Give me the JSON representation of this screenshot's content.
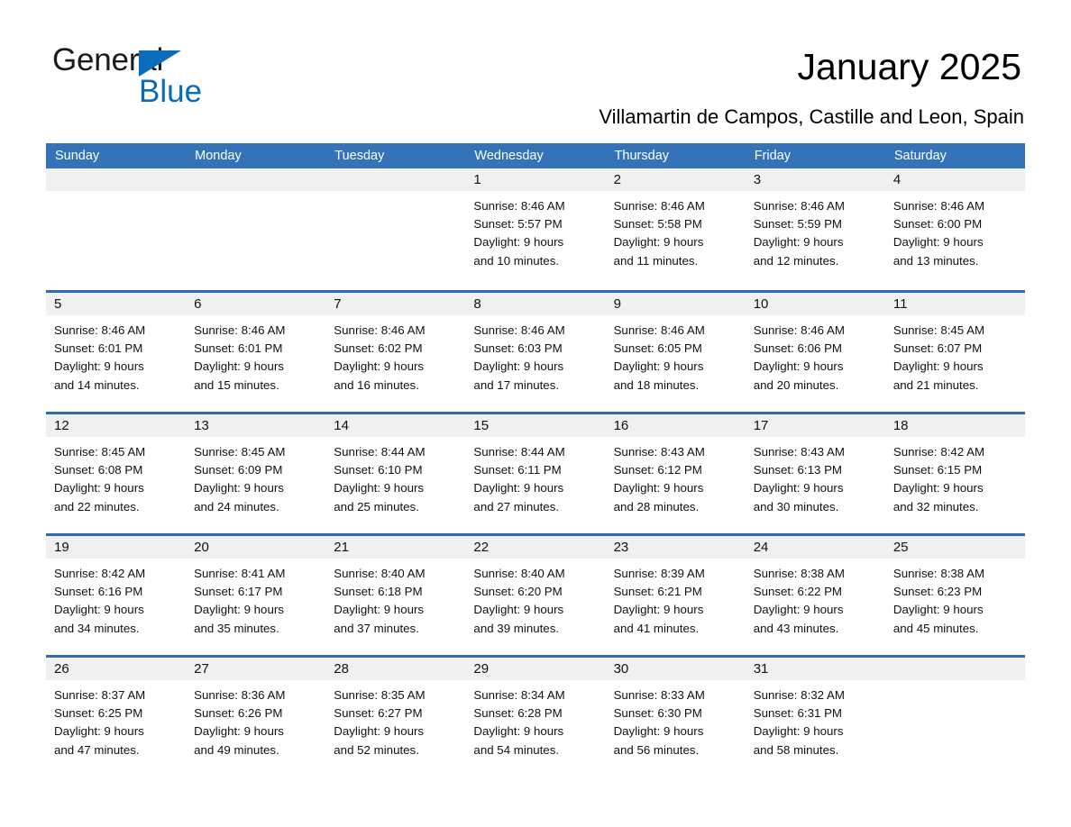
{
  "brand": {
    "name_part1": "General",
    "name_part2": "Blue"
  },
  "header": {
    "title": "January 2025",
    "subtitle": "Villamartin de Campos, Castille and Leon, Spain"
  },
  "colors": {
    "header_blue": "#3573b9",
    "row_divider_blue": "#2e6da9",
    "day_band_gray": "#f0f0f0",
    "brand_blue": "#0a6cb8"
  },
  "weekdays": [
    "Sunday",
    "Monday",
    "Tuesday",
    "Wednesday",
    "Thursday",
    "Friday",
    "Saturday"
  ],
  "weeks": [
    [
      {
        "day": "",
        "empty": true,
        "sunrise": "",
        "sunset": "",
        "daylight1": "",
        "daylight2": ""
      },
      {
        "day": "",
        "empty": true,
        "sunrise": "",
        "sunset": "",
        "daylight1": "",
        "daylight2": ""
      },
      {
        "day": "",
        "empty": true,
        "sunrise": "",
        "sunset": "",
        "daylight1": "",
        "daylight2": ""
      },
      {
        "day": "1",
        "sunrise": "Sunrise: 8:46 AM",
        "sunset": "Sunset: 5:57 PM",
        "daylight1": "Daylight: 9 hours",
        "daylight2": "and 10 minutes."
      },
      {
        "day": "2",
        "sunrise": "Sunrise: 8:46 AM",
        "sunset": "Sunset: 5:58 PM",
        "daylight1": "Daylight: 9 hours",
        "daylight2": "and 11 minutes."
      },
      {
        "day": "3",
        "sunrise": "Sunrise: 8:46 AM",
        "sunset": "Sunset: 5:59 PM",
        "daylight1": "Daylight: 9 hours",
        "daylight2": "and 12 minutes."
      },
      {
        "day": "4",
        "sunrise": "Sunrise: 8:46 AM",
        "sunset": "Sunset: 6:00 PM",
        "daylight1": "Daylight: 9 hours",
        "daylight2": "and 13 minutes."
      }
    ],
    [
      {
        "day": "5",
        "sunrise": "Sunrise: 8:46 AM",
        "sunset": "Sunset: 6:01 PM",
        "daylight1": "Daylight: 9 hours",
        "daylight2": "and 14 minutes."
      },
      {
        "day": "6",
        "sunrise": "Sunrise: 8:46 AM",
        "sunset": "Sunset: 6:01 PM",
        "daylight1": "Daylight: 9 hours",
        "daylight2": "and 15 minutes."
      },
      {
        "day": "7",
        "sunrise": "Sunrise: 8:46 AM",
        "sunset": "Sunset: 6:02 PM",
        "daylight1": "Daylight: 9 hours",
        "daylight2": "and 16 minutes."
      },
      {
        "day": "8",
        "sunrise": "Sunrise: 8:46 AM",
        "sunset": "Sunset: 6:03 PM",
        "daylight1": "Daylight: 9 hours",
        "daylight2": "and 17 minutes."
      },
      {
        "day": "9",
        "sunrise": "Sunrise: 8:46 AM",
        "sunset": "Sunset: 6:05 PM",
        "daylight1": "Daylight: 9 hours",
        "daylight2": "and 18 minutes."
      },
      {
        "day": "10",
        "sunrise": "Sunrise: 8:46 AM",
        "sunset": "Sunset: 6:06 PM",
        "daylight1": "Daylight: 9 hours",
        "daylight2": "and 20 minutes."
      },
      {
        "day": "11",
        "sunrise": "Sunrise: 8:45 AM",
        "sunset": "Sunset: 6:07 PM",
        "daylight1": "Daylight: 9 hours",
        "daylight2": "and 21 minutes."
      }
    ],
    [
      {
        "day": "12",
        "sunrise": "Sunrise: 8:45 AM",
        "sunset": "Sunset: 6:08 PM",
        "daylight1": "Daylight: 9 hours",
        "daylight2": "and 22 minutes."
      },
      {
        "day": "13",
        "sunrise": "Sunrise: 8:45 AM",
        "sunset": "Sunset: 6:09 PM",
        "daylight1": "Daylight: 9 hours",
        "daylight2": "and 24 minutes."
      },
      {
        "day": "14",
        "sunrise": "Sunrise: 8:44 AM",
        "sunset": "Sunset: 6:10 PM",
        "daylight1": "Daylight: 9 hours",
        "daylight2": "and 25 minutes."
      },
      {
        "day": "15",
        "sunrise": "Sunrise: 8:44 AM",
        "sunset": "Sunset: 6:11 PM",
        "daylight1": "Daylight: 9 hours",
        "daylight2": "and 27 minutes."
      },
      {
        "day": "16",
        "sunrise": "Sunrise: 8:43 AM",
        "sunset": "Sunset: 6:12 PM",
        "daylight1": "Daylight: 9 hours",
        "daylight2": "and 28 minutes."
      },
      {
        "day": "17",
        "sunrise": "Sunrise: 8:43 AM",
        "sunset": "Sunset: 6:13 PM",
        "daylight1": "Daylight: 9 hours",
        "daylight2": "and 30 minutes."
      },
      {
        "day": "18",
        "sunrise": "Sunrise: 8:42 AM",
        "sunset": "Sunset: 6:15 PM",
        "daylight1": "Daylight: 9 hours",
        "daylight2": "and 32 minutes."
      }
    ],
    [
      {
        "day": "19",
        "sunrise": "Sunrise: 8:42 AM",
        "sunset": "Sunset: 6:16 PM",
        "daylight1": "Daylight: 9 hours",
        "daylight2": "and 34 minutes."
      },
      {
        "day": "20",
        "sunrise": "Sunrise: 8:41 AM",
        "sunset": "Sunset: 6:17 PM",
        "daylight1": "Daylight: 9 hours",
        "daylight2": "and 35 minutes."
      },
      {
        "day": "21",
        "sunrise": "Sunrise: 8:40 AM",
        "sunset": "Sunset: 6:18 PM",
        "daylight1": "Daylight: 9 hours",
        "daylight2": "and 37 minutes."
      },
      {
        "day": "22",
        "sunrise": "Sunrise: 8:40 AM",
        "sunset": "Sunset: 6:20 PM",
        "daylight1": "Daylight: 9 hours",
        "daylight2": "and 39 minutes."
      },
      {
        "day": "23",
        "sunrise": "Sunrise: 8:39 AM",
        "sunset": "Sunset: 6:21 PM",
        "daylight1": "Daylight: 9 hours",
        "daylight2": "and 41 minutes."
      },
      {
        "day": "24",
        "sunrise": "Sunrise: 8:38 AM",
        "sunset": "Sunset: 6:22 PM",
        "daylight1": "Daylight: 9 hours",
        "daylight2": "and 43 minutes."
      },
      {
        "day": "25",
        "sunrise": "Sunrise: 8:38 AM",
        "sunset": "Sunset: 6:23 PM",
        "daylight1": "Daylight: 9 hours",
        "daylight2": "and 45 minutes."
      }
    ],
    [
      {
        "day": "26",
        "sunrise": "Sunrise: 8:37 AM",
        "sunset": "Sunset: 6:25 PM",
        "daylight1": "Daylight: 9 hours",
        "daylight2": "and 47 minutes."
      },
      {
        "day": "27",
        "sunrise": "Sunrise: 8:36 AM",
        "sunset": "Sunset: 6:26 PM",
        "daylight1": "Daylight: 9 hours",
        "daylight2": "and 49 minutes."
      },
      {
        "day": "28",
        "sunrise": "Sunrise: 8:35 AM",
        "sunset": "Sunset: 6:27 PM",
        "daylight1": "Daylight: 9 hours",
        "daylight2": "and 52 minutes."
      },
      {
        "day": "29",
        "sunrise": "Sunrise: 8:34 AM",
        "sunset": "Sunset: 6:28 PM",
        "daylight1": "Daylight: 9 hours",
        "daylight2": "and 54 minutes."
      },
      {
        "day": "30",
        "sunrise": "Sunrise: 8:33 AM",
        "sunset": "Sunset: 6:30 PM",
        "daylight1": "Daylight: 9 hours",
        "daylight2": "and 56 minutes."
      },
      {
        "day": "31",
        "sunrise": "Sunrise: 8:32 AM",
        "sunset": "Sunset: 6:31 PM",
        "daylight1": "Daylight: 9 hours",
        "daylight2": "and 58 minutes."
      },
      {
        "day": "",
        "empty": true,
        "sunrise": "",
        "sunset": "",
        "daylight1": "",
        "daylight2": ""
      }
    ]
  ]
}
